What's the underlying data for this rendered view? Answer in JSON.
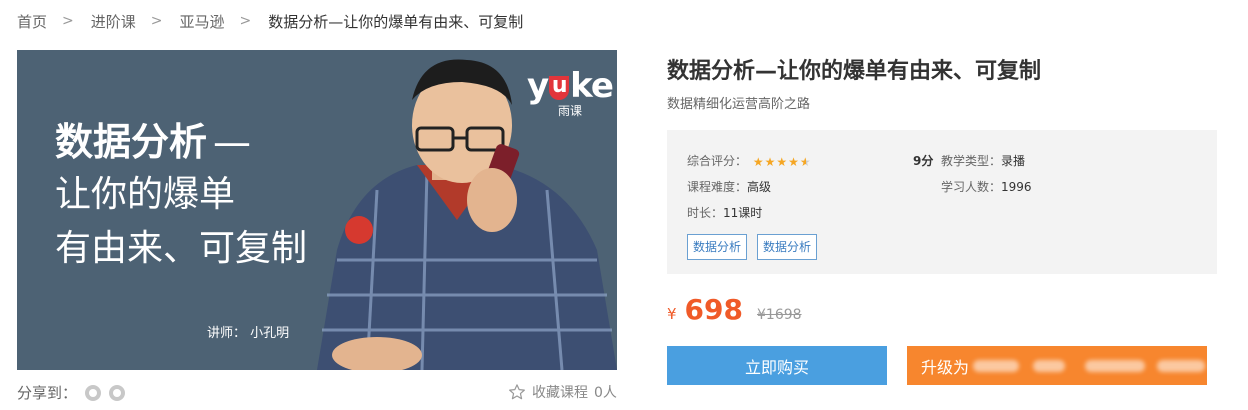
{
  "breadcrumb": {
    "items": [
      "首页",
      "进阶课",
      "亚马逊",
      "数据分析—让你的爆单有由来、可复制"
    ],
    "separator": ">"
  },
  "cover": {
    "title_line1": "数据分析",
    "title_dash": "—",
    "title_line2": "让你的爆单",
    "title_line3": "有由来、可复制",
    "logo_word_start": "y",
    "logo_word_u": "u",
    "logo_word_end": "ke",
    "logo_sub": "雨课",
    "lecturer": "讲师：  小孔明",
    "background_color": "#4d6274"
  },
  "share": {
    "label": "分享到：",
    "icons": [
      "wechat-icon",
      "weibo-icon"
    ]
  },
  "favorite": {
    "label": "收藏课程",
    "count": "0人"
  },
  "course": {
    "title": "数据分析—让你的爆单有由来、可复制",
    "subtitle": "数据精细化运营高阶之路",
    "rating_label": "综合评分：",
    "rating_stars": 4.5,
    "score": "9分",
    "type_label": "教学类型：",
    "type_value": "录播",
    "difficulty_label": "课程难度：",
    "difficulty_value": "高级",
    "students_label": "学习人数：",
    "students_value": "1996",
    "duration_label": "时长：",
    "duration_value": "11课时",
    "tags": [
      "数据分析",
      "数据分析"
    ]
  },
  "price": {
    "currency": "¥",
    "current": "698",
    "original": "¥1698"
  },
  "buttons": {
    "buy": "立即购买",
    "upgrade_visible": "升级为"
  },
  "colors": {
    "accent_blue": "#4a9fe0",
    "accent_orange": "#f7862e",
    "price_red": "#f05a28",
    "star": "#f5a623"
  }
}
